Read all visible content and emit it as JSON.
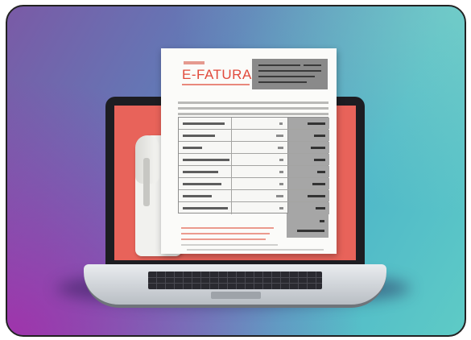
{
  "illustration": {
    "document_title": "E-FATURA",
    "accent_color": "#e14a3c",
    "screen_color": "#e8635a",
    "table_rows": 8,
    "icons": [
      "laptop-icon",
      "receipt-icon",
      "invoice-document-icon"
    ]
  }
}
